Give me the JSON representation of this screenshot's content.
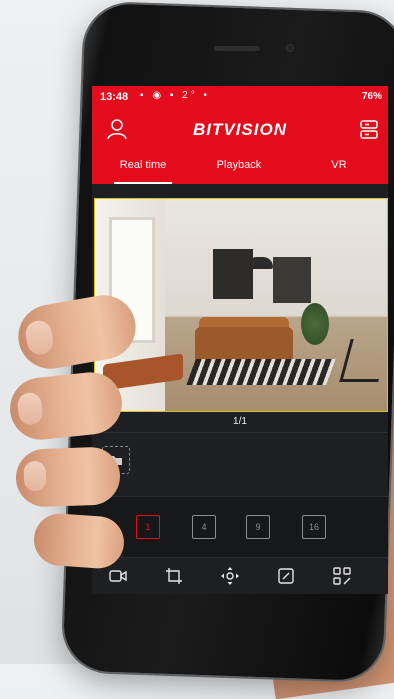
{
  "status_bar": {
    "time": "13:48",
    "left_icons": "▪ ◉ ▪ 2° •",
    "right_text": "76%"
  },
  "app": {
    "brand": "BITVISION"
  },
  "tabs": [
    {
      "label": "Real time",
      "active": true
    },
    {
      "label": "Playback"
    },
    {
      "label": "VR"
    }
  ],
  "video": {
    "page_indicator": "1/1"
  },
  "grid_options": [
    {
      "label": "1",
      "active": true
    },
    {
      "label": "4"
    },
    {
      "label": "9"
    },
    {
      "label": "16"
    }
  ],
  "toolbar": {
    "icons": [
      "record-icon",
      "snapshot-icon",
      "ptz-icon",
      "playback-icon",
      "grid-settings-icon"
    ]
  },
  "colors": {
    "accent": "#e30b1c",
    "screen_bg": "#1d1f22",
    "video_border": "#d9c21a"
  }
}
